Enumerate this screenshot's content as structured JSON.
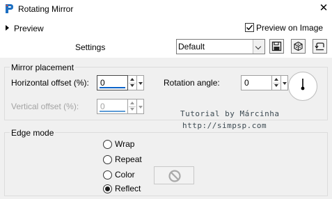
{
  "window": {
    "title": "Rotating Mirror",
    "app_icon": "paintshop-pro-icon",
    "close_glyph": "✕"
  },
  "header": {
    "preview_label": "Preview",
    "preview_on_image_label": "Preview on Image",
    "preview_on_image_checked": true,
    "settings_label": "Settings",
    "settings_value": "Default",
    "tool_buttons": [
      "save-preset-icon",
      "manage-presets-icon",
      "reset-icon"
    ]
  },
  "mirror_placement": {
    "title": "Mirror placement",
    "horizontal_label": "Horizontal offset (%):",
    "horizontal_value": "0",
    "vertical_label": "Vertical offset (%):",
    "vertical_value": "0",
    "rotation_label": "Rotation angle:",
    "rotation_value": "0"
  },
  "watermark": {
    "line1": "Tutorial by Márcinha",
    "line2": "http://simpsp.com"
  },
  "edge_mode": {
    "title": "Edge mode",
    "options": [
      "Wrap",
      "Repeat",
      "Color",
      "Reflect"
    ],
    "selected": "Reflect"
  },
  "colors": {
    "accent": "#0a63c9",
    "panel_bg": "#f0f0f0",
    "disabled_text": "#a3a3a3"
  }
}
